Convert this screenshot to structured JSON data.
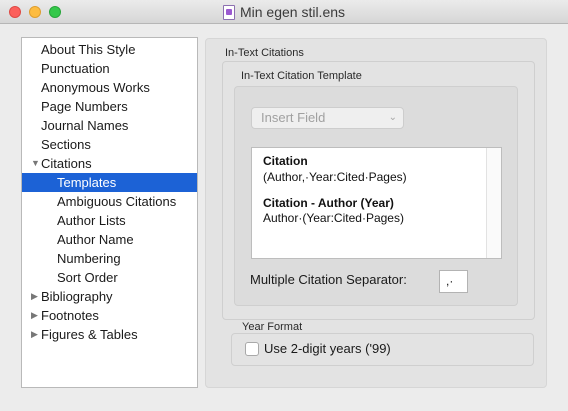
{
  "window": {
    "title": "Min egen stil.ens",
    "controls": {
      "close_glyph": "×",
      "minimize_glyph": "−",
      "zoom_glyph": "+"
    }
  },
  "sidebar": {
    "items": [
      {
        "label": "About This Style",
        "level": 1
      },
      {
        "label": "Punctuation",
        "level": 1
      },
      {
        "label": "Anonymous Works",
        "level": 1
      },
      {
        "label": "Page Numbers",
        "level": 1
      },
      {
        "label": "Journal Names",
        "level": 1
      },
      {
        "label": "Sections",
        "level": 1
      },
      {
        "label": "Citations",
        "level": 1,
        "disclosure": "▼"
      },
      {
        "label": "Templates",
        "level": 2,
        "selected": true
      },
      {
        "label": "Ambiguous Citations",
        "level": 2
      },
      {
        "label": "Author Lists",
        "level": 2
      },
      {
        "label": "Author Name",
        "level": 2
      },
      {
        "label": "Numbering",
        "level": 2
      },
      {
        "label": "Sort Order",
        "level": 2
      },
      {
        "label": "Bibliography",
        "level": 1,
        "disclosure": "▶"
      },
      {
        "label": "Footnotes",
        "level": 1,
        "disclosure": "▶"
      },
      {
        "label": "Figures & Tables",
        "level": 1,
        "disclosure": "▶"
      }
    ]
  },
  "main": {
    "section_title": "In-Text Citations",
    "template_group_title": "In-Text Citation Template",
    "insert_field": {
      "label": "Insert Field",
      "chevron": "⌄"
    },
    "template_lines": [
      {
        "text": "Citation",
        "bold": true
      },
      {
        "text": "(Author,·Year:Cited·Pages)",
        "bold": false
      },
      {
        "text": "Citation - Author (Year)",
        "bold": true
      },
      {
        "text": "Author·(Year:Cited·Pages)",
        "bold": false
      }
    ],
    "separator": {
      "label": "Multiple Citation Separator:",
      "value": ",·"
    },
    "year_format": {
      "title": "Year Format",
      "checkbox_label": "Use 2-digit years ('99)",
      "checked": false
    }
  },
  "colors": {
    "selection": "#1c62d6",
    "close": "#fc605c",
    "minimize": "#fdbc40",
    "zoom": "#34c84a"
  }
}
